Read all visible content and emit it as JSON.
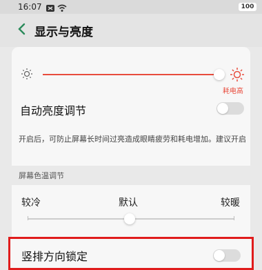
{
  "status_bar": {
    "time": "16:07",
    "battery": "100"
  },
  "header": {
    "title": "显示与亮度"
  },
  "brightness": {
    "level": 1.0,
    "high_power_label": "耗电高"
  },
  "auto_brightness": {
    "label": "自动亮度调节",
    "enabled": false,
    "description": "开启后，可防止屏幕长时间过亮造成眼睛疲劳和耗电增加。建议开启"
  },
  "color_temperature": {
    "section_label": "屏幕色温调节",
    "cool_label": "较冷",
    "default_label": "默认",
    "warm_label": "较暖",
    "level": 0.5
  },
  "orientation_lock": {
    "label": "竖排方向锁定",
    "enabled": false
  },
  "colors": {
    "accent": "#e84c3d",
    "highlight_border": "#e01c1c"
  }
}
